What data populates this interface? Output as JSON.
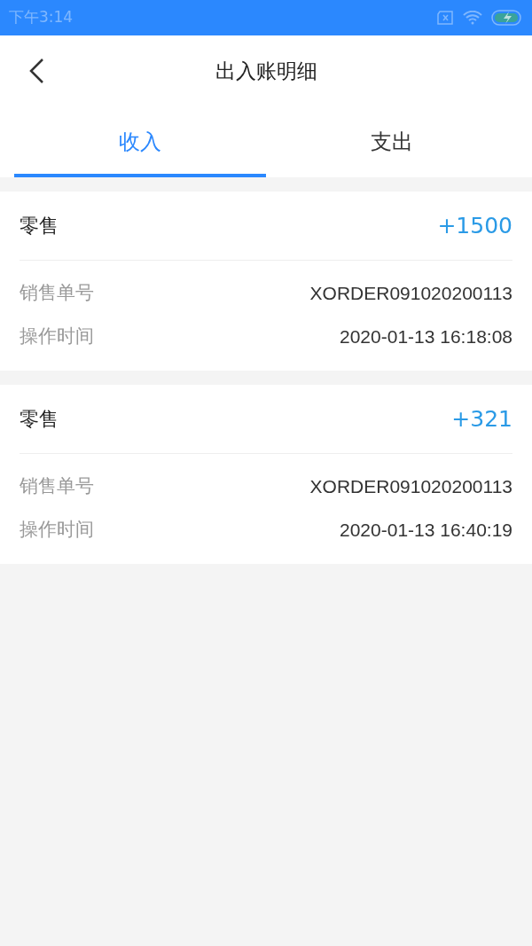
{
  "status_bar": {
    "time": "下午3:14"
  },
  "header": {
    "title": "出入账明细"
  },
  "tabs": [
    {
      "label": "收入",
      "selected": true
    },
    {
      "label": "支出",
      "selected": false
    }
  ],
  "records": [
    {
      "type": "零售",
      "amount": "+1500",
      "fields": [
        {
          "label": "销售单号",
          "value": "XORDER091020200113"
        },
        {
          "label": "操作时间",
          "value": "2020-01-13 16:18:08"
        }
      ]
    },
    {
      "type": "零售",
      "amount": "+321",
      "fields": [
        {
          "label": "销售单号",
          "value": "XORDER091020200113"
        },
        {
          "label": "操作时间",
          "value": "2020-01-13 16:40:19"
        }
      ]
    }
  ]
}
